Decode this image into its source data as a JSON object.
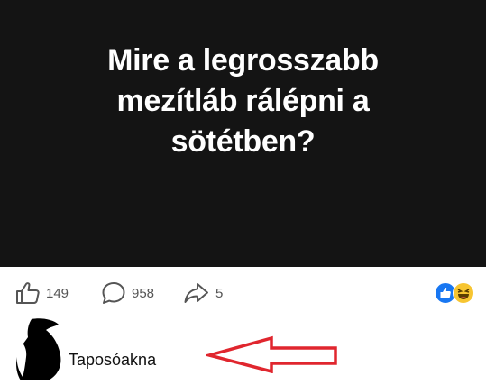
{
  "post": {
    "text": "Mire a legrosszabb mezítláb rálépni a sötétben?",
    "background_color": "#141414"
  },
  "actions": {
    "like": {
      "icon": "thumbs-up-icon",
      "count": "149"
    },
    "comment": {
      "icon": "comment-bubble-icon",
      "count": "958"
    },
    "share": {
      "icon": "share-arrow-icon",
      "count": "5"
    }
  },
  "reactions": [
    "like-reaction-icon",
    "haha-reaction-icon"
  ],
  "comment": {
    "author": "Taposóakna"
  },
  "annotation": {
    "icon": "red-arrow-icon",
    "color": "#e0262e"
  }
}
